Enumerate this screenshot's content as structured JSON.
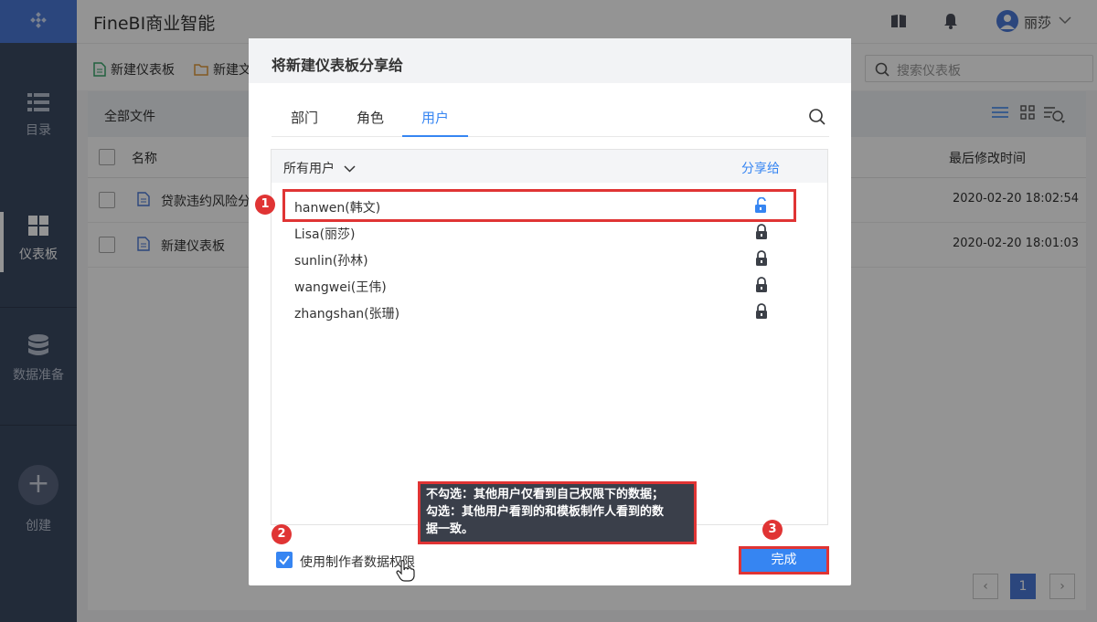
{
  "app": {
    "title": "FineBI商业智能",
    "user_name": "丽莎"
  },
  "sidebar": {
    "items": [
      {
        "label": "目录"
      },
      {
        "label": "仪表板"
      },
      {
        "label": "数据准备"
      },
      {
        "label": "创建"
      }
    ]
  },
  "toolbar": {
    "new_dashboard": "新建仪表板",
    "new_folder": "新建文",
    "search_placeholder": "搜索仪表板"
  },
  "file_panel": {
    "breadcrumb": "全部文件",
    "col_name": "名称",
    "col_modified": "最后修改时间",
    "rows": [
      {
        "name": "贷款违约风险分",
        "modified": "2020-02-20 18:02:54"
      },
      {
        "name": "新建仪表板",
        "modified": "2020-02-20 18:01:03"
      }
    ],
    "pagination": {
      "current": "1"
    }
  },
  "dialog": {
    "title": "将新建仪表板分享给",
    "tabs": [
      "部门",
      "角色",
      "用户"
    ],
    "active_tab": "用户",
    "list_filter": "所有用户",
    "share_header": "分享给",
    "users": [
      {
        "name": "hanwen(韩文)",
        "unlocked": true
      },
      {
        "name": "Lisa(丽莎)",
        "unlocked": false
      },
      {
        "name": "sunlin(孙林)",
        "unlocked": false
      },
      {
        "name": "wangwei(王伟)",
        "unlocked": false
      },
      {
        "name": "zhangshan(张珊)",
        "unlocked": false
      }
    ],
    "tooltip_lines": [
      "不勾选：其他用户仅看到自己权限下的数据；",
      "勾选：其他用户看到的和模板制作人看到的数",
      "据一致。"
    ],
    "checkbox_label": "使用制作者数据权限",
    "checkbox_checked": true,
    "confirm_label": "完成"
  },
  "annotations": {
    "badge_1": "1",
    "badge_2": "2",
    "badge_3": "3"
  },
  "colors": {
    "accent": "#3685f2",
    "highlight": "#e03434",
    "sidebar": "#3c4a63"
  }
}
